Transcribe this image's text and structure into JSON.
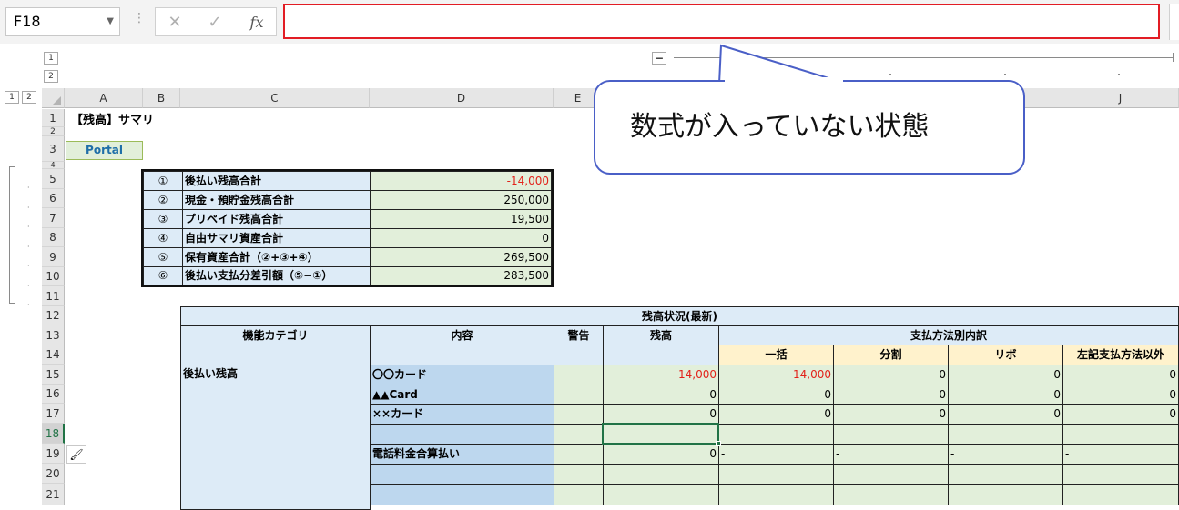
{
  "formula_bar": {
    "name_box": "F18",
    "cancel_icon": "✕",
    "enter_icon": "✓",
    "fx_label": "fx",
    "formula_value": ""
  },
  "outline": {
    "row_levels": [
      "1",
      "2"
    ],
    "col_levels": [
      "1",
      "2"
    ],
    "collapse_symbol": "−"
  },
  "columns": [
    "A",
    "B",
    "C",
    "D",
    "E",
    "",
    "",
    "",
    "",
    "J"
  ],
  "rows": [
    "1",
    "2",
    "3",
    "4",
    "5",
    "6",
    "7",
    "8",
    "9",
    "10",
    "11",
    "12",
    "13",
    "14",
    "15",
    "16",
    "17",
    "18",
    "19",
    "20",
    "21"
  ],
  "title": "【残高】サマリ",
  "portal_button": "Portal",
  "summary": [
    {
      "mark": "①",
      "label": "後払い残高合計",
      "value": "-14,000",
      "neg": true
    },
    {
      "mark": "②",
      "label": "現金・預貯金残高合計",
      "value": "250,000",
      "neg": false
    },
    {
      "mark": "③",
      "label": "プリペイド残高合計",
      "value": "19,500",
      "neg": false
    },
    {
      "mark": "④",
      "label": "自由サマリ資産合計",
      "value": "0",
      "neg": false
    },
    {
      "mark": "⑤",
      "label": "保有資産合計（②+③+④）",
      "value": "269,500",
      "neg": false
    },
    {
      "mark": "⑥",
      "label": "後払い支払分差引額（⑤−①）",
      "value": "283,500",
      "neg": false
    }
  ],
  "main_table": {
    "title": "残高状況(最新)",
    "col_category": "機能カテゴリ",
    "col_content": "内容",
    "col_warning": "警告",
    "col_balance": "残高",
    "col_breakdown": "支払方法別内訳",
    "breakdown_cols": [
      "一括",
      "分割",
      "リボ",
      "左記支払方法以外"
    ],
    "category": "後払い残高",
    "rows": [
      {
        "content": "〇〇カード",
        "balance": "-14,000",
        "b1": "-14,000",
        "b2": "0",
        "b3": "0",
        "b4": "0",
        "neg": true
      },
      {
        "content": "▲▲Card",
        "balance": "0",
        "b1": "0",
        "b2": "0",
        "b3": "0",
        "b4": "0",
        "neg": false
      },
      {
        "content": "××カード",
        "balance": "0",
        "b1": "0",
        "b2": "0",
        "b3": "0",
        "b4": "0",
        "neg": false
      },
      {
        "content": "",
        "balance": "",
        "b1": "",
        "b2": "",
        "b3": "",
        "b4": "",
        "neg": false
      },
      {
        "content": "電話料金合算払い",
        "balance": "0",
        "b1": "-",
        "b2": "-",
        "b3": "-",
        "b4": "-",
        "neg": false
      },
      {
        "content": "",
        "balance": "",
        "b1": "",
        "b2": "",
        "b3": "",
        "b4": "",
        "neg": false
      },
      {
        "content": "",
        "balance": "",
        "b1": "",
        "b2": "",
        "b3": "",
        "b4": "",
        "neg": false
      }
    ]
  },
  "callout_text": "数式が入っていない状態",
  "colors": {
    "accent_green": "#217346",
    "callout_border": "#4a5fc7",
    "formula_border": "#e21c24",
    "negative": "#e2231a"
  }
}
